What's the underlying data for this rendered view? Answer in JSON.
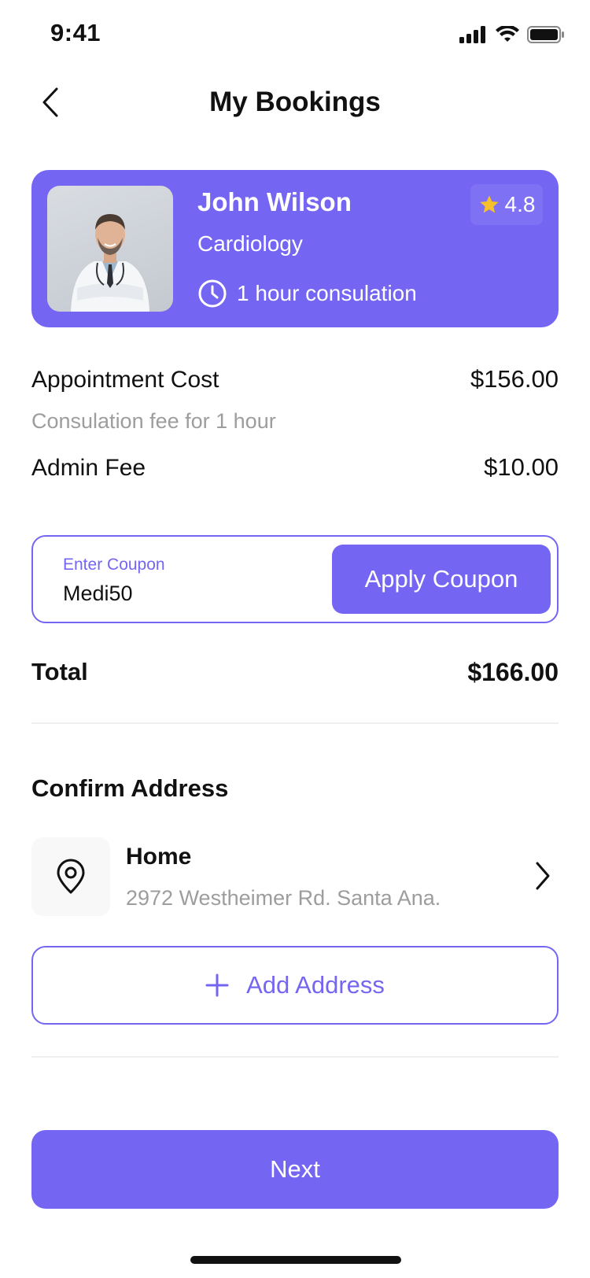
{
  "status_bar": {
    "time": "9:41"
  },
  "header": {
    "title": "My Bookings"
  },
  "doctor": {
    "name": "John Wilson",
    "specialty": "Cardiology",
    "duration": "1 hour consulation",
    "rating": "4.8",
    "rating_star_color": "#F5C02B"
  },
  "costs": {
    "appointment_label": "Appointment Cost",
    "appointment_value": "$156.00",
    "appointment_note": "Consulation fee for 1 hour",
    "admin_label": "Admin Fee",
    "admin_value": "$10.00"
  },
  "coupon": {
    "label": "Enter Coupon",
    "value": "Medi50",
    "apply_label": "Apply Coupon"
  },
  "total": {
    "label": "Total",
    "value": "$166.00"
  },
  "address": {
    "section_title": "Confirm Address",
    "title": "Home",
    "line": "2972 Westheimer Rd. Santa Ana.",
    "add_label": "Add Address"
  },
  "footer": {
    "next_label": "Next"
  },
  "colors": {
    "accent": "#7565F3",
    "muted_text": "#9D9D9D"
  }
}
